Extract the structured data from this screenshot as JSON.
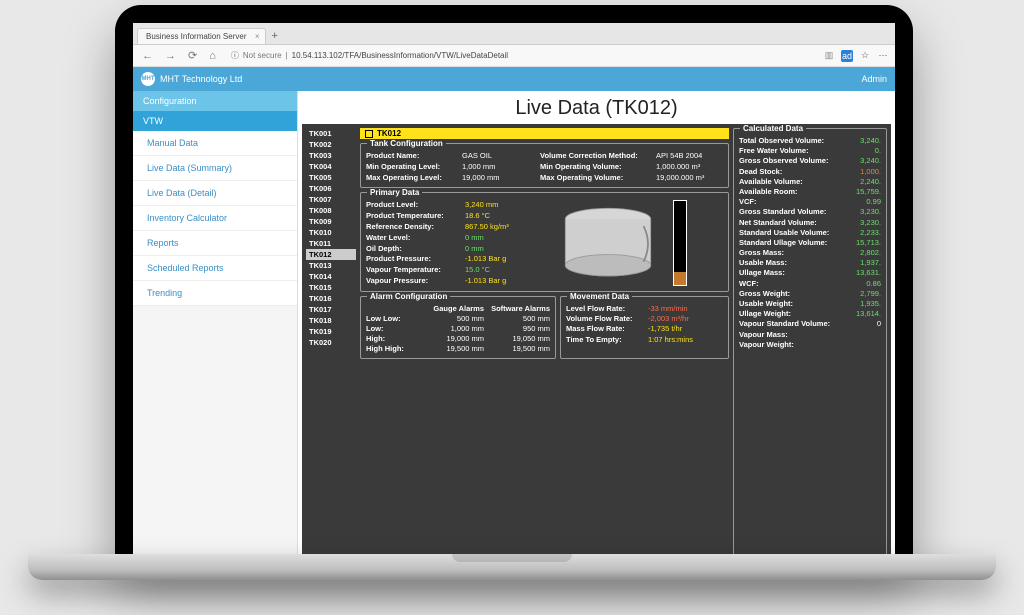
{
  "browser": {
    "tab_title": "Business Information Server",
    "not_secure": "Not secure",
    "url": "10.54.113.102/TFA/BusinessInformation/VTW/LiveDataDetail"
  },
  "header": {
    "brand": "MHT Technology Ltd",
    "right": "Admin"
  },
  "sidebar": {
    "config": "Configuration",
    "vtw": "VTW",
    "items": [
      "Manual Data",
      "Live Data (Summary)",
      "Live Data (Detail)",
      "Inventory Calculator",
      "Reports",
      "Scheduled Reports",
      "Trending"
    ]
  },
  "page_title": "Live Data (TK012)",
  "tanks": [
    "TK001",
    "TK002",
    "TK003",
    "TK004",
    "TK005",
    "TK006",
    "TK007",
    "TK008",
    "TK009",
    "TK010",
    "TK011",
    "TK012",
    "TK013",
    "TK014",
    "TK015",
    "TK016",
    "TK017",
    "TK018",
    "TK019",
    "TK020"
  ],
  "selected_tank": "TK012",
  "tank_config": {
    "title": "Tank Configuration",
    "product_name_l": "Product Name:",
    "product_name": "GAS OIL",
    "vcm_l": "Volume Correction Method:",
    "vcm": "API 54B 2004",
    "min_lvl_l": "Min Operating Level:",
    "min_lvl": "1,000 mm",
    "min_vol_l": "Min Operating Volume:",
    "min_vol": "1,000.000 m³",
    "max_lvl_l": "Max Operating Level:",
    "max_lvl": "19,000 mm",
    "max_vol_l": "Max Operating Volume:",
    "max_vol": "19,000.000 m³"
  },
  "primary": {
    "title": "Primary Data",
    "p_level_l": "Product Level:",
    "p_level": "3,240 mm",
    "p_temp_l": "Product Temperature:",
    "p_temp": "18.6 °C",
    "ref_dens_l": "Reference Density:",
    "ref_dens": "867.50 kg/m³",
    "water_l": "Water Level:",
    "water": "0 mm",
    "oil_l": "Oil Depth:",
    "oil": "0 mm",
    "p_press_l": "Product Pressure:",
    "p_press": "-1.013 Bar g",
    "v_temp_l": "Vapour Temperature:",
    "v_temp": "15.0 °C",
    "v_press_l": "Vapour Pressure:",
    "v_press": "-1.013 Bar g"
  },
  "alarms": {
    "title": "Alarm Configuration",
    "col1": "Gauge Alarms",
    "col2": "Software Alarms",
    "lowlow_l": "Low Low:",
    "lowlow_g": "500 mm",
    "lowlow_s": "500 mm",
    "low_l": "Low:",
    "low_g": "1,000 mm",
    "low_s": "950 mm",
    "high_l": "High:",
    "high_g": "19,000 mm",
    "high_s": "19,050 mm",
    "hh_l": "High High:",
    "hh_g": "19,500 mm",
    "hh_s": "19,500 mm"
  },
  "movement": {
    "title": "Movement Data",
    "lfr_l": "Level Flow Rate:",
    "lfr": "-33 mm/min",
    "vfr_l": "Volume Flow Rate:",
    "vfr": "-2,003 m³/hr",
    "mfr_l": "Mass Flow Rate:",
    "mfr": "-1,735 t/hr",
    "tte_l": "Time To Empty:",
    "tte": "1:07 hrs:mins"
  },
  "calc": {
    "title": "Calculated Data",
    "rows": [
      {
        "l": "Total Observed Volume:",
        "v": "3,240.",
        "c": "green"
      },
      {
        "l": "Free Water Volume:",
        "v": "0.",
        "c": "green"
      },
      {
        "l": "Gross Observed Volume:",
        "v": "3,240.",
        "c": "green"
      },
      {
        "l": "Dead Stock:",
        "v": "1,000.",
        "c": "orange"
      },
      {
        "l": "Available Volume:",
        "v": "2,240.",
        "c": "green"
      },
      {
        "l": "Available Room:",
        "v": "15,759.",
        "c": "green"
      },
      {
        "l": "VCF:",
        "v": "0.99",
        "c": "green"
      },
      {
        "l": "Gross Standard Volume:",
        "v": "3,230.",
        "c": "green"
      },
      {
        "l": "Net Standard Volume:",
        "v": "3,230.",
        "c": "green"
      },
      {
        "l": "Standard Usable Volume:",
        "v": "2,233.",
        "c": "green"
      },
      {
        "l": "Standard Ullage Volume:",
        "v": "15,713.",
        "c": "green"
      },
      {
        "l": "Gross Mass:",
        "v": "2,802.",
        "c": "green"
      },
      {
        "l": "Usable Mass:",
        "v": "1,937.",
        "c": "green"
      },
      {
        "l": "Ullage Mass:",
        "v": "13,631.",
        "c": "green"
      },
      {
        "l": "WCF:",
        "v": "0.86",
        "c": "green"
      },
      {
        "l": "Gross Weight:",
        "v": "2,799.",
        "c": "green"
      },
      {
        "l": "Usable Weight:",
        "v": "1,935.",
        "c": "green"
      },
      {
        "l": "Ullage Weight:",
        "v": "13,614.",
        "c": "green"
      },
      {
        "l": "Vapour Standard Volume:",
        "v": "0",
        "c": ""
      },
      {
        "l": "Vapour Mass:",
        "v": "",
        "c": ""
      },
      {
        "l": "Vapour Weight:",
        "v": "",
        "c": ""
      }
    ]
  }
}
